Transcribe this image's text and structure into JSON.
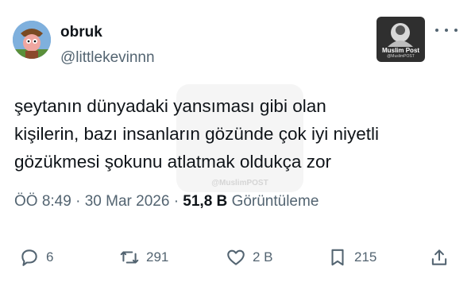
{
  "author": {
    "name": "obruk",
    "handle": "@littlekevinnn"
  },
  "badge": {
    "title": "Muslim Post",
    "subtitle": "@MuslimPOST"
  },
  "watermark": {
    "text": "@MuslimPOST"
  },
  "tweet": {
    "lines": [
      "şeytanın dünyadaki yansıması gibi olan",
      "kişilerin, bazı insanların gözünde çok iyi niyetli",
      "gözükmesi şokunu atlatmak oldukça zor"
    ]
  },
  "meta": {
    "time": "ÖÖ 8:49",
    "separator": "·",
    "date": "30 Mar 2026",
    "views_count": "51,8 B",
    "views_label": "Görüntüleme"
  },
  "actions": {
    "replies": "6",
    "reposts": "291",
    "likes": "2 B",
    "bookmarks": "215"
  },
  "icons": [
    "more-icon",
    "reply-icon",
    "repost-icon",
    "like-icon",
    "bookmark-icon",
    "share-icon"
  ],
  "colors": {
    "text": "#0f1419",
    "muted": "#536471"
  }
}
